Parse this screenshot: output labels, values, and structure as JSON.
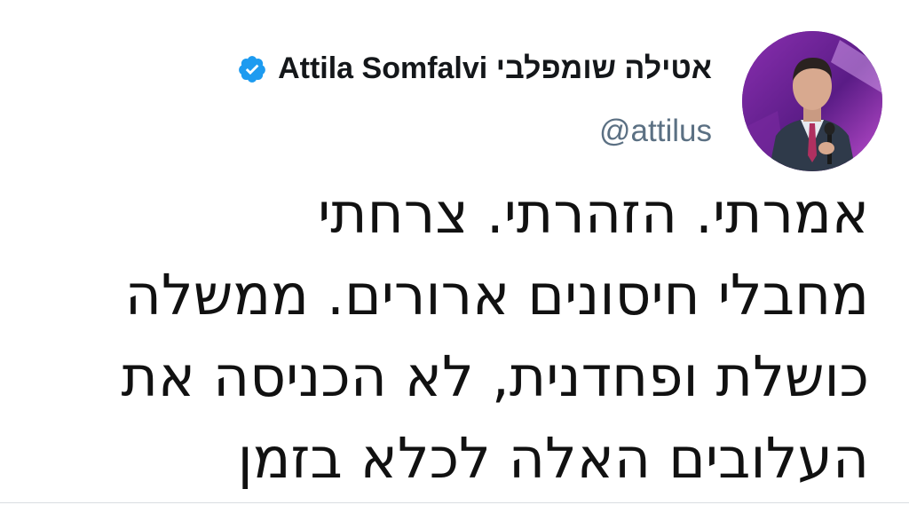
{
  "author": {
    "display_name": "אטילה שומפלבי Attila Somfalvi",
    "handle": "@attilus",
    "verified": true,
    "avatar_icon": "profile-photo",
    "verified_icon": "verified-badge-icon"
  },
  "tweet": {
    "lines": [
      "אמרתי. הזהרתי. צרחתי",
      "מחבלי חיסונים ארורים. ממשלה",
      "כושלת ופחדנית, לא הכניסה את",
      "העלובים האלה לכלא בזמן"
    ]
  },
  "colors": {
    "verified_blue": "#1d9bf0",
    "handle_gray": "#5b7083",
    "text": "#111111"
  }
}
